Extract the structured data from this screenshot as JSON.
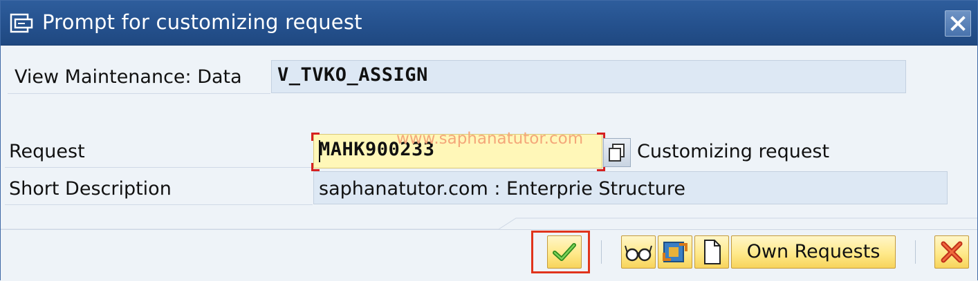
{
  "dialog": {
    "title": "Prompt for customizing request",
    "icons": {
      "title": "dialog-prompt-icon",
      "close": "close-icon"
    }
  },
  "form": {
    "view_label": "View Maintenance: Data",
    "view_value": "V_TVKO_ASSIGN",
    "request_label": "Request",
    "request_value": "MAHK900233",
    "request_type_label": "Customizing request",
    "watermark": "www.saphanatutor.com",
    "short_desc_label": "Short Description",
    "short_desc_value": "saphanatutor.com : Enterprie Structure"
  },
  "toolbar": {
    "own_requests_label": "Own Requests",
    "icons": [
      "checkmark-icon",
      "glasses-icon",
      "transport-icon",
      "new-document-icon",
      "cancel-icon"
    ]
  },
  "colors": {
    "titlebar": "#24508c",
    "required_field": "#fff7b8",
    "button_gold": "#ffe98a",
    "highlight": "#e0341c"
  }
}
